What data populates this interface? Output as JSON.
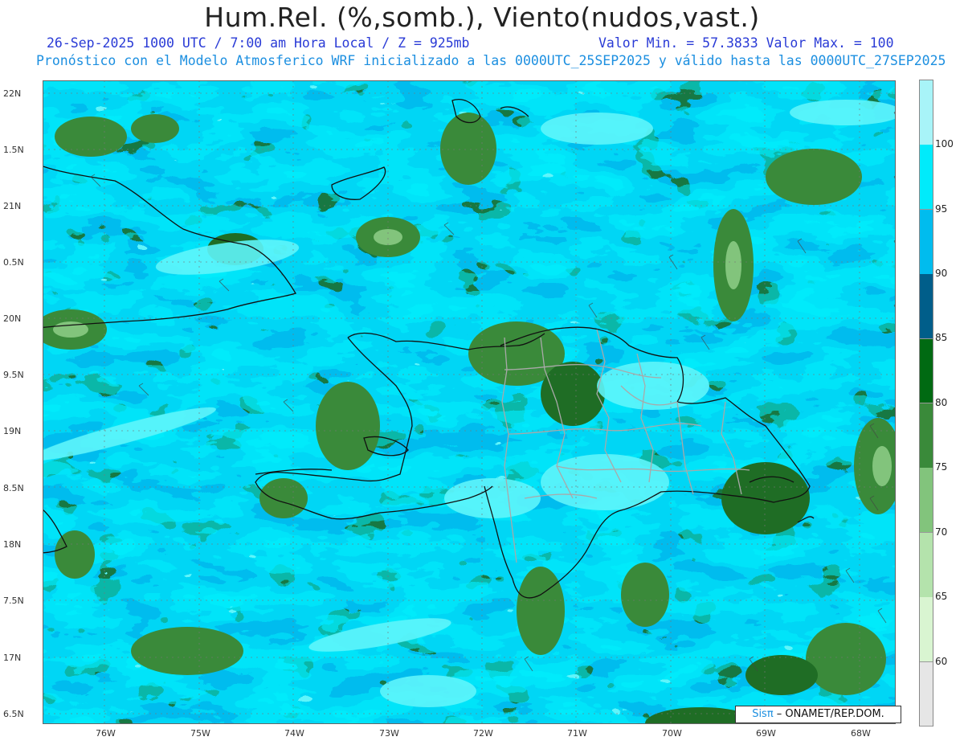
{
  "header": {
    "title": "Hum.Rel. (%,somb.), Viento(nudos,vast.)",
    "line1_left": "26-Sep-2025  1000 UTC / 7:00 am Hora Local / Z = 925mb",
    "line1_right": "Valor Min. = 57.3833  Valor Max. = 100",
    "line2": "Pronóstico con el Modelo Atmosferico WRF inicializado a las 0000UTC_25SEP2025 y válido hasta las  0000UTC_27SEP2025"
  },
  "map": {
    "lat_ticks": [
      "22N",
      "1.5N",
      "21N",
      "0.5N",
      "20N",
      "9.5N",
      "19N",
      "8.5N",
      "18N",
      "7.5N",
      "17N",
      "6.5N"
    ],
    "lon_ticks": [
      "76W",
      "75W",
      "74W",
      "73W",
      "72W",
      "71W",
      "70W",
      "69W",
      "68W"
    ]
  },
  "colorbar": {
    "labels": [
      "100",
      "95",
      "90",
      "85",
      "80",
      "75",
      "70",
      "65",
      "60"
    ],
    "colors": [
      "#a8f4f8",
      "#00ebfb",
      "#00bcee",
      "#005e8a",
      "#006a12",
      "#3a8a3a",
      "#82c47c",
      "#b4e3ac",
      "#d9f5d1",
      "#e6e6e6"
    ]
  },
  "credit": {
    "sis": "Sisπ",
    "text": " – ONAMET/REP.DOM."
  }
}
